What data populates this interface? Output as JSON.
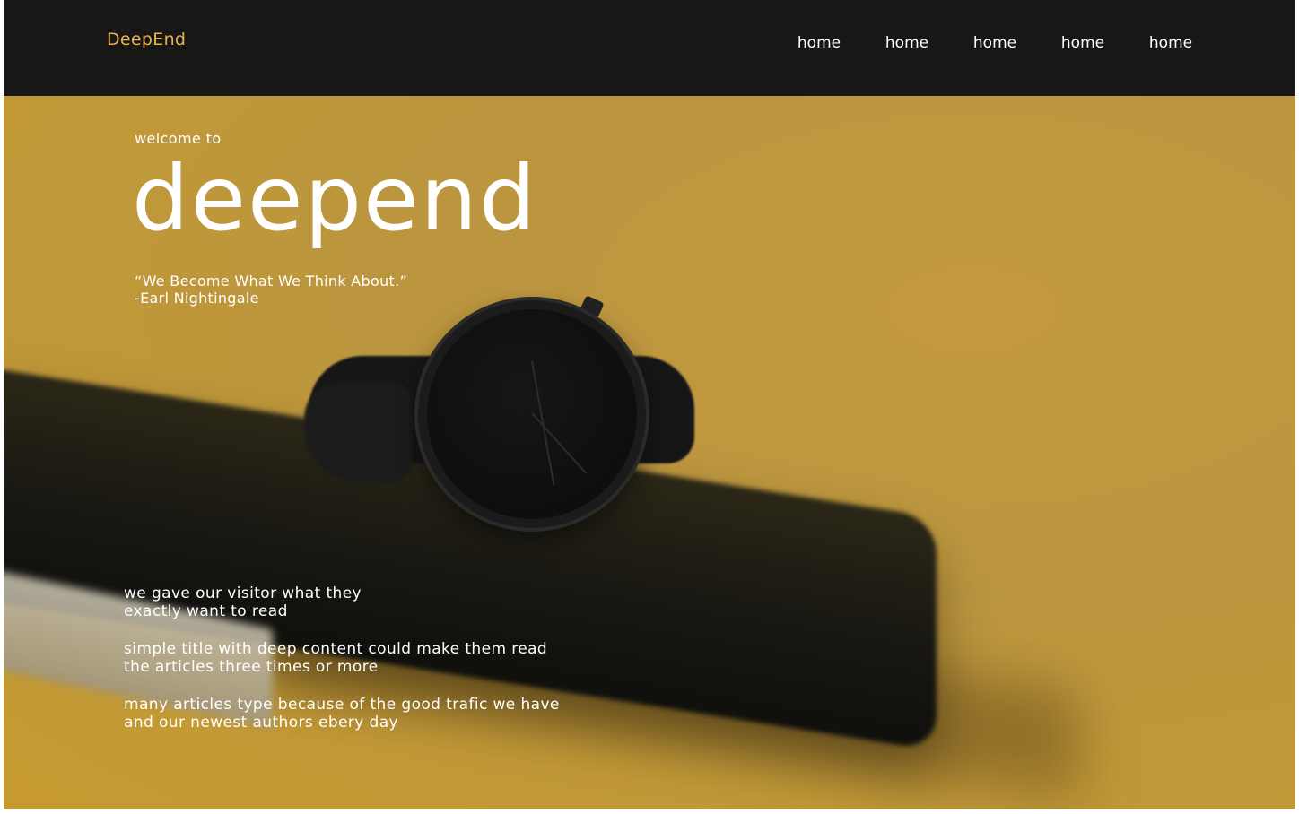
{
  "navbar": {
    "logo": "DeepEnd",
    "links": [
      "home",
      "home",
      "home",
      "home",
      "home"
    ]
  },
  "hero": {
    "welcome": "welcome to",
    "title": "deepend",
    "quote_line1": "“We Become What We Think About.”",
    "quote_line2": "-Earl Nightingale",
    "paragraphs": [
      "we gave our visitor what they\nexactly want to read",
      "simple title with deep content could make them read\nthe articles three times or more",
      "many articles type because of the good trafic we have\nand our newest authors ebery day"
    ]
  },
  "colors": {
    "navbar_bg": "#171717",
    "logo": "#e7b34a",
    "hero_bg": "#bb963f",
    "text": "#ffffff"
  }
}
